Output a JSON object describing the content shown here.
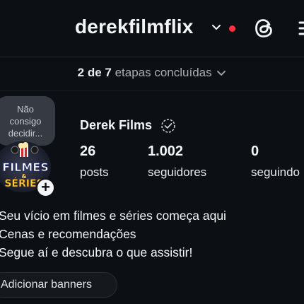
{
  "header": {
    "username": "derekfilmflix",
    "icons": [
      "chevron-down-icon",
      "notification-dot",
      "threads-icon",
      "menu-icon"
    ],
    "notification_color": "#ff3040"
  },
  "steps": {
    "count": "2 de 7",
    "text": "etapas concluídas"
  },
  "profile": {
    "note": [
      "Não",
      "consigo",
      "decidir..."
    ],
    "avatar_text": [
      "FILMES",
      "&",
      "SÉRIES"
    ],
    "display_name": "Derek Films",
    "stats": [
      {
        "value": "26",
        "label": "posts"
      },
      {
        "value": "1.002",
        "label": "seguidores"
      },
      {
        "value": "0",
        "label": "seguindo"
      }
    ]
  },
  "bio": [
    "Seu vício em filmes e séries começa aqui",
    "Cenas e recomendações",
    "Segue aí e descubra o que assistir!"
  ],
  "actions": {
    "add_banners": "Adicionar banners"
  }
}
